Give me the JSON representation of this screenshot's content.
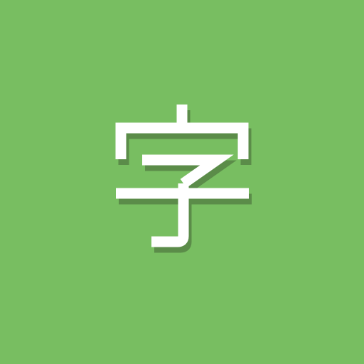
{
  "app_icon": {
    "glyph": "字",
    "background_color": "#78BE61",
    "glyph_color": "#FFFFFF",
    "shadow_color": "#5B8C49"
  }
}
